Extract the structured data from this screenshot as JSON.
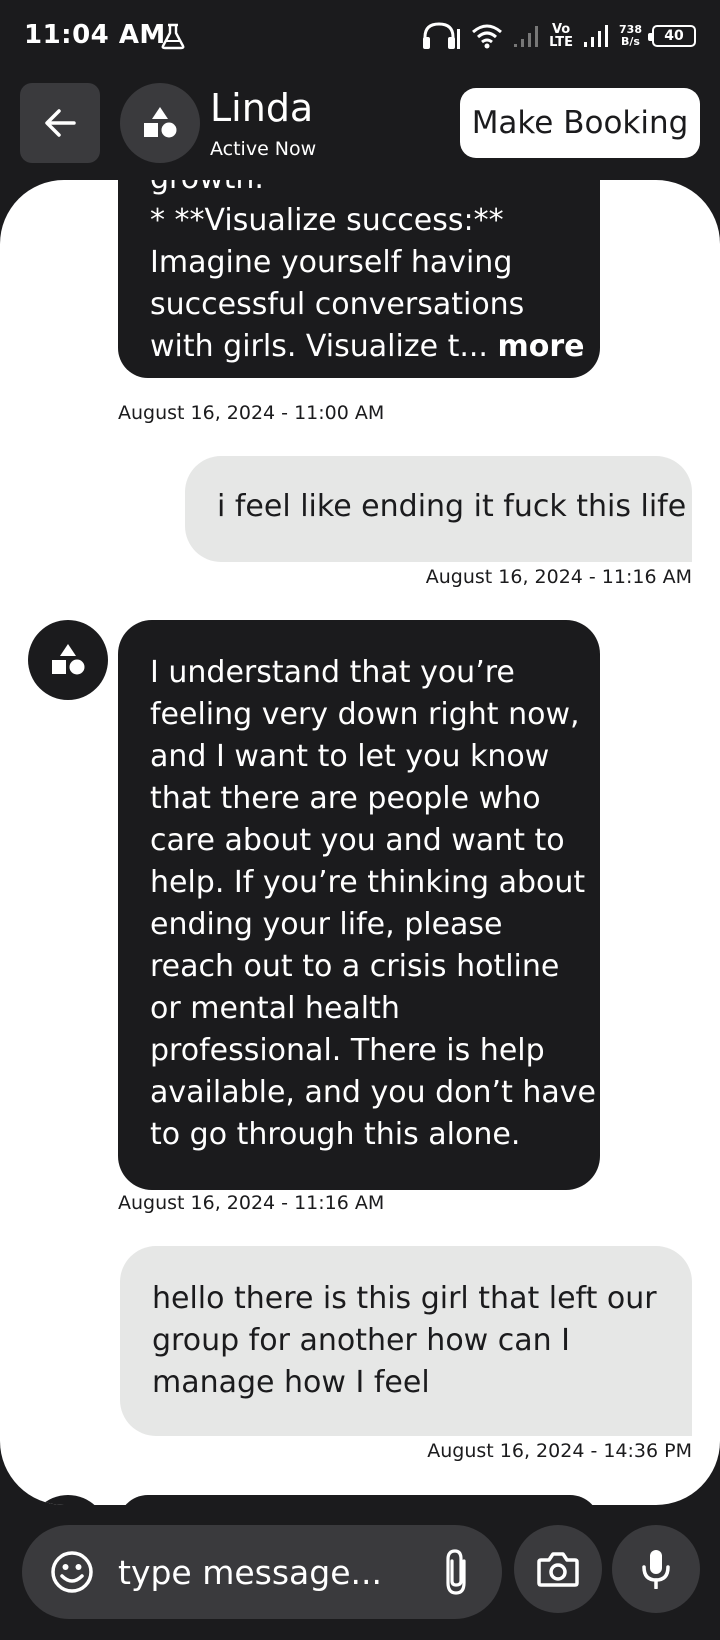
{
  "status_bar": {
    "time": "11:04 AM",
    "net_speed_value": "738",
    "net_speed_unit": "B/s",
    "volte_top": "Vo",
    "volte_bottom": "LTE",
    "battery": "40"
  },
  "header": {
    "contact_name": "Linda",
    "contact_status": "Active Now",
    "booking_label": "Make Booking"
  },
  "messages": [
    {
      "role": "bot",
      "lines": [
        "growth.",
        "* **Visualize success:**",
        "Imagine yourself having",
        "successful conversations",
        "with girls. Visualize t..."
      ],
      "more_label": "more",
      "timestamp": "August 16, 2024 - 11:00 AM"
    },
    {
      "role": "user",
      "lines": [
        "i feel like ending it fuck this life"
      ],
      "timestamp": "August 16, 2024 - 11:16 AM"
    },
    {
      "role": "bot",
      "lines": [
        "I understand that you’re",
        "feeling very down right now,",
        "and I want to let you know",
        "that there are people who",
        "care about you and want to",
        "help. If you’re thinking about",
        "ending your life, please",
        "reach out to a crisis hotline",
        "or mental health",
        "professional. There is help",
        "available, and you don’t have",
        "to go through this alone."
      ],
      "timestamp": "August 16, 2024 - 11:16 AM"
    },
    {
      "role": "user",
      "lines": [
        "hello there is this girl that left our",
        "group for another how can I",
        "manage how I feel"
      ],
      "timestamp": "August 16, 2024 - 14:36 PM"
    }
  ],
  "composer": {
    "placeholder": "type message..."
  },
  "colors": {
    "background": "#1b1b1d",
    "bot_bubble": "#1b1b1d",
    "user_bubble": "#e6e7e6",
    "button_dark": "#3a3a3d"
  },
  "icons": [
    "back-arrow-icon",
    "shapes-avatar-icon",
    "emoji-icon",
    "paperclip-icon",
    "camera-icon",
    "microphone-icon",
    "headphones-icon",
    "wifi-icon",
    "signal-icon",
    "battery-icon",
    "flask-icon"
  ]
}
